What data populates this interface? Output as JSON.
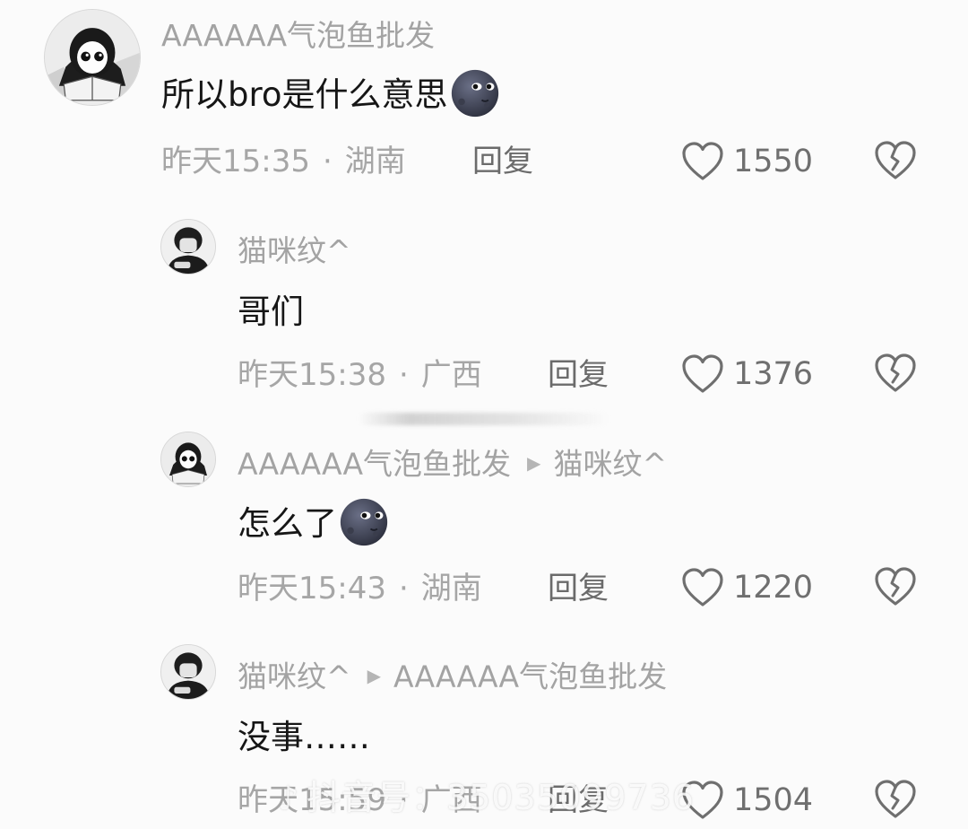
{
  "comments": [
    {
      "username": "AAAAAA气泡鱼批发",
      "reply_to": "",
      "text": "所以bro是什么意思",
      "emoji": "new-moon-face",
      "time": "昨天15:35",
      "location": "湖南",
      "reply_label": "回复",
      "likes": "1550"
    },
    {
      "username": "猫咪纹^",
      "reply_to": "",
      "text": "哥们",
      "emoji": "",
      "time": "昨天15:38",
      "location": "广西",
      "reply_label": "回复",
      "likes": "1376"
    },
    {
      "username": "AAAAAA气泡鱼批发",
      "reply_to": "猫咪纹^",
      "text": "怎么了",
      "emoji": "new-moon-face",
      "time": "昨天15:43",
      "location": "湖南",
      "reply_label": "回复",
      "likes": "1220"
    },
    {
      "username": "猫咪纹^",
      "reply_to": "AAAAAA气泡鱼批发",
      "text": "没事……",
      "emoji": "",
      "time": "昨天15:59",
      "location": "广西",
      "reply_label": "回复",
      "likes": "1504"
    }
  ],
  "separator": "·",
  "icons": {
    "like": "heart-outline-icon",
    "dislike": "broken-heart-icon",
    "reply_arrow": "triangle-right-icon"
  },
  "watermark": {
    "brand": "抖音号",
    "id": "35035099736"
  },
  "colors": {
    "background": "#fbfbfb",
    "username": "#a3a3a3",
    "text": "#161616",
    "meta": "#a6a6a6",
    "reply": "#6b6b6b",
    "icon": "#6f6f6f"
  }
}
